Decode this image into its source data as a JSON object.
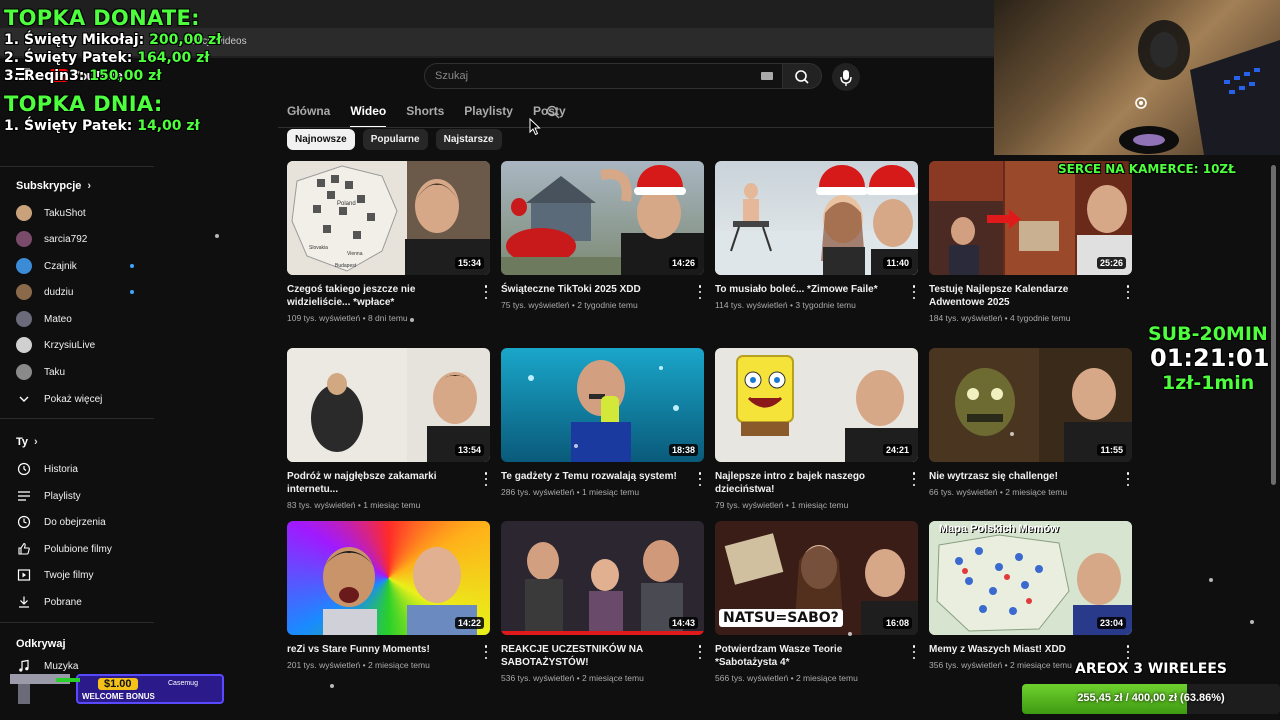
{
  "browser": {
    "address": "eakcje/videos"
  },
  "header": {
    "logo_text": "YouTube",
    "search_placeholder": "Szukaj"
  },
  "tabs": [
    "Główna",
    "Wideo",
    "Shorts",
    "Playlisty",
    "Posty"
  ],
  "chips": [
    "Najnowsze",
    "Popularne",
    "Najstarsze"
  ],
  "sidebar": {
    "subscriptions_title": "Subskrypcje",
    "subscriptions": [
      {
        "name": "TakuShot",
        "color": "#c9a27c",
        "dot": false
      },
      {
        "name": "sarcia792",
        "color": "#7a4a6a",
        "dot": false
      },
      {
        "name": "Czajnik",
        "color": "#3b8bd6",
        "dot": true
      },
      {
        "name": "dudziu",
        "color": "#8a6a4a",
        "dot": true
      },
      {
        "name": "Mateo",
        "color": "#6a6a7a",
        "dot": false
      },
      {
        "name": "KrzysiuLive",
        "color": "#d0d0d0",
        "dot": false
      },
      {
        "name": "Taku",
        "color": "#8a8a8a",
        "dot": false
      }
    ],
    "show_more": "Pokaż więcej",
    "you_title": "Ty",
    "you_items": [
      {
        "label": "Historia",
        "icon": "history-icon"
      },
      {
        "label": "Playlisty",
        "icon": "playlist-icon"
      },
      {
        "label": "Do obejrzenia",
        "icon": "clock-icon"
      },
      {
        "label": "Polubione filmy",
        "icon": "thumb-up-icon"
      },
      {
        "label": "Twoje filmy",
        "icon": "play-square-icon"
      },
      {
        "label": "Pobrane",
        "icon": "download-icon"
      }
    ],
    "explore_title": "Odkrywaj",
    "explore_items": [
      {
        "label": "Muzyka",
        "icon": "music-icon"
      }
    ]
  },
  "videos": [
    {
      "title": "Czegoś takiego jeszcze nie widzieliście... *wpłace*",
      "views": "109 tys. wyświetleń",
      "age": "8 dni temu",
      "duration": "15:34"
    },
    {
      "title": "Świąteczne TikToki 2025 XDD",
      "views": "75 tys. wyświetleń",
      "age": "2 tygodnie temu",
      "duration": "14:26"
    },
    {
      "title": "To musiało boleć... *Zimowe Faile*",
      "views": "114 tys. wyświetleń",
      "age": "3 tygodnie temu",
      "duration": "11:40"
    },
    {
      "title": "Testuję Najlepsze Kalendarze Adwentowe 2025",
      "views": "184 tys. wyświetleń",
      "age": "4 tygodnie temu",
      "duration": "25:26"
    },
    {
      "title": "Podróż w najgłębsze zakamarki internetu...",
      "views": "83 tys. wyświetleń",
      "age": "1 miesiąc temu",
      "duration": "13:54"
    },
    {
      "title": "Te gadżety z Temu rozwalają system!",
      "views": "286 tys. wyświetleń",
      "age": "1 miesiąc temu",
      "duration": "18:38"
    },
    {
      "title": "Najlepsze intro z bajek naszego dzieciństwa!",
      "views": "79 tys. wyświetleń",
      "age": "1 miesiąc temu",
      "duration": "24:21"
    },
    {
      "title": "Nie wytrzasz się challenge!",
      "views": "66 tys. wyświetleń",
      "age": "2 miesiące temu",
      "duration": "11:55"
    },
    {
      "title": "reZi vs Stare Funny Moments!",
      "views": "201 tys. wyświetleń",
      "age": "2 miesiące temu",
      "duration": "14:22"
    },
    {
      "title": "REAKCJE UCZESTNIKÓW NA SABOTAŻYSTÓW!",
      "views": "536 tys. wyświetleń",
      "age": "2 miesiące temu",
      "duration": "14:43"
    },
    {
      "title": "Potwierdzam Wasze Teorie *Sabotażysta 4*",
      "views": "566 tys. wyświetleń",
      "age": "2 miesiące temu",
      "duration": "16:08"
    },
    {
      "title": "Memy z Waszych Miast! XDD",
      "views": "356 tys. wyświetleń",
      "age": "2 miesiące temu",
      "duration": "23:04"
    }
  ],
  "thumb_text": {
    "map_title": "Mapa Polskich Memów",
    "natsu": "NATSU=SABO?",
    "map_labels": [
      "Poland",
      "Vienna",
      "Budapest",
      "Slovakia"
    ]
  },
  "overlay": {
    "donate_title": "TOPKA DONATE:",
    "donate_rows": [
      {
        "rank": "1.",
        "name": "Święty Mikołaj:",
        "amount": "200,00 zł"
      },
      {
        "rank": "2.",
        "name": "Święty Patek:",
        "amount": "164,00 zł"
      },
      {
        "rank": "3.",
        "name": "Reqin3:",
        "amount": "150,00 zł"
      }
    ],
    "daily_title": "TOPKA DNIA:",
    "daily_rows": [
      {
        "rank": "1.",
        "name": "Święty Patek:",
        "amount": "14,00 zł"
      }
    ],
    "serce_text": "SERCE NA KAMERCE: 10ZŁ",
    "sub_title": "SUB-20MIN",
    "timer": "01:21:01",
    "rate": "1zł-1min",
    "goal_name": "AREOX 3 WIRELEES",
    "goal_text": "255,45 zł / 400,00 zł (63.86%)",
    "goal_fraction": 0.6386,
    "bonus_amount": "$1.00",
    "bonus_label": "WELCOME BONUS",
    "bonus_brand": "Casemug"
  }
}
